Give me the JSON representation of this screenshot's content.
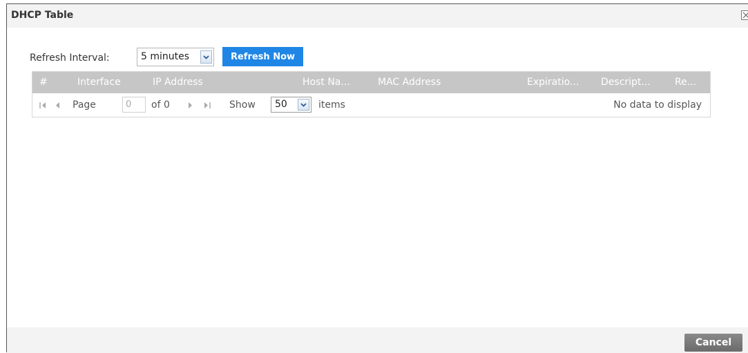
{
  "dialog": {
    "title": "DHCP Table",
    "close_icon": "close-icon"
  },
  "toolbar": {
    "refresh_interval_label": "Refresh Interval:",
    "refresh_interval_value": "5 minutes",
    "refresh_now_label": "Refresh Now"
  },
  "table": {
    "columns": [
      "#",
      "Interface",
      "IP Address",
      "Host Na...",
      "MAC Address",
      "Expiratio...",
      "Descript...",
      "Re..."
    ],
    "rows": []
  },
  "pager": {
    "page_label": "Page",
    "page_value": "0",
    "of_label": "of 0",
    "show_label": "Show",
    "items_per_page": "50",
    "items_label": "items",
    "status": "No data to display"
  },
  "footer": {
    "cancel_label": "Cancel"
  },
  "colors": {
    "primary_button": "#1f86e5",
    "header_bg": "#c6c6c6",
    "cancel_button": "#777777"
  }
}
